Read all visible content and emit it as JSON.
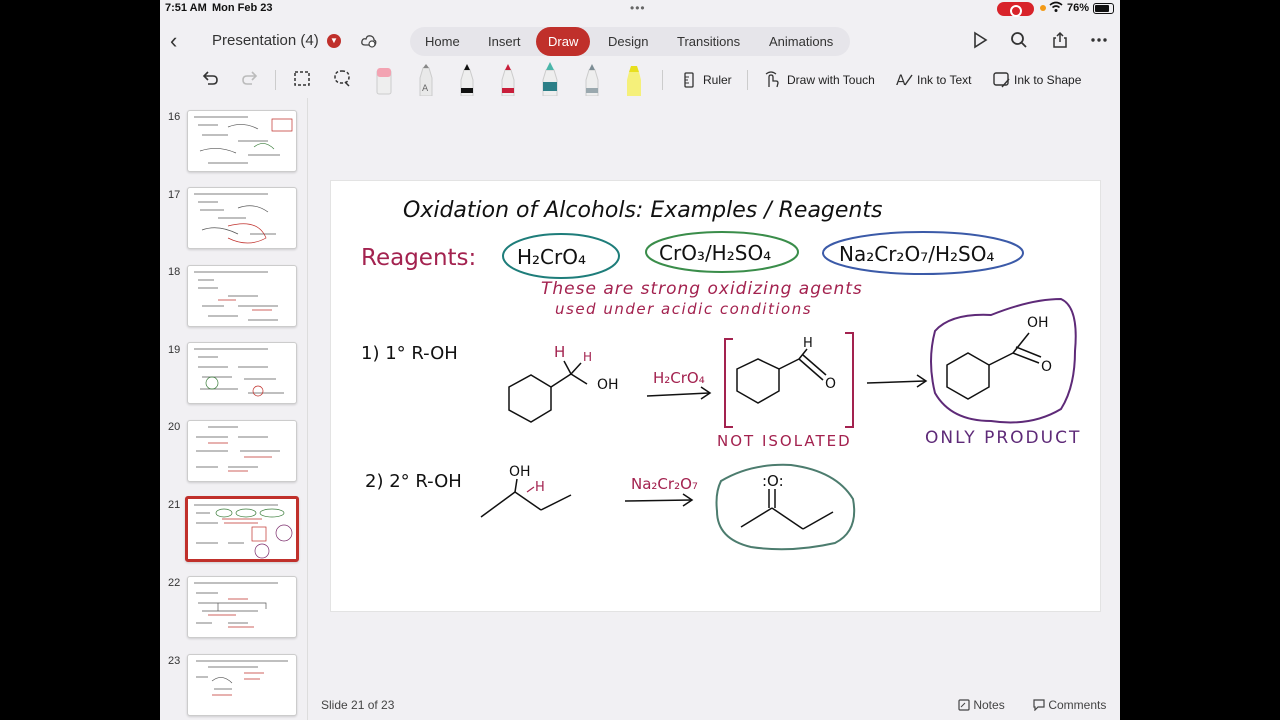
{
  "status_bar": {
    "time": "7:51 AM",
    "date": "Mon Feb 23",
    "dots": "•••",
    "battery_pct": "76%"
  },
  "title_bar": {
    "back": "‹",
    "document_title": "Presentation (4)",
    "tabs": [
      "Home",
      "Insert",
      "Draw",
      "Design",
      "Transitions",
      "Animations"
    ],
    "active_tab": "Draw"
  },
  "ribbon": {
    "ruler": "Ruler",
    "draw_with_touch": "Draw with Touch",
    "ink_to_text": "Ink to Text",
    "ink_to_shape": "Ink to Shape"
  },
  "thumbnails": [
    "16",
    "17",
    "18",
    "19",
    "20",
    "21",
    "22",
    "23"
  ],
  "selected_slide": "21",
  "footer": {
    "slide_count": "Slide 21 of 23",
    "notes": "Notes",
    "comments": "Comments"
  },
  "slide": {
    "title": "Oxidation of Alcohols:  Examples / Reagents",
    "reagents_label": "Reagents:",
    "reagent_1": "H₂CrO₄",
    "reagent_2": "CrO₃/H₂SO₄",
    "reagent_3": "Na₂Cr₂O₇/H₂SO₄",
    "note_line_1": "These are strong oxidizing agents",
    "note_line_2": "used under acidic conditions",
    "case_1_label": "1)  1° R-OH",
    "case_1_h": "H",
    "case_1_h2": "H",
    "case_1_oh": "OH",
    "case_1_reagent": "H₂CrO₄",
    "aldehyde_h": "H",
    "aldehyde_o": "O",
    "not_isolated": "NOT ISOLATED",
    "acid_oh": "OH",
    "acid_o": "O",
    "only_product": "ONLY PRODUCT",
    "case_2_label": "2)  2° R-OH",
    "case_2_oh": "OH",
    "case_2_h": "H",
    "case_2_reagent": "Na₂Cr₂O₇",
    "ketone_o": ":O:"
  }
}
